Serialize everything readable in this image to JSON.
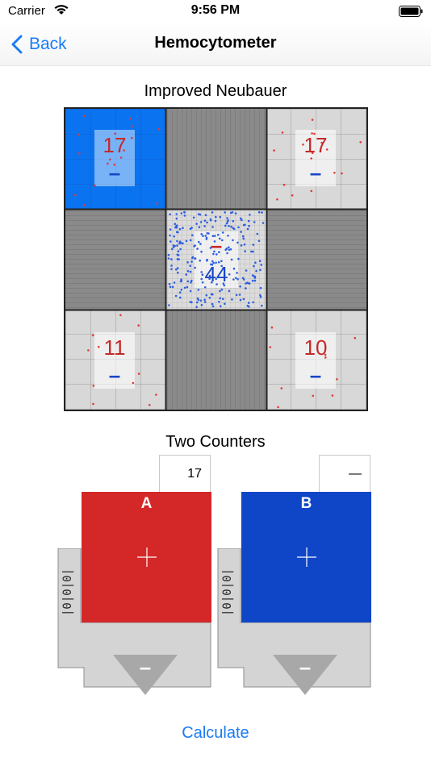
{
  "status_bar": {
    "carrier": "Carrier",
    "time": "9:56 PM"
  },
  "nav": {
    "back_label": "Back",
    "title": "Hemocytometer"
  },
  "grid": {
    "title": "Improved Neubauer",
    "squares": {
      "top_left": {
        "count": "17",
        "minus": "–",
        "selected": true
      },
      "top_right": {
        "count": "17",
        "minus": "–",
        "selected": false
      },
      "center": {
        "count": "44",
        "minus": "–"
      },
      "bottom_left": {
        "count": "11",
        "minus": "–",
        "selected": false
      },
      "bottom_right": {
        "count": "10",
        "minus": "–",
        "selected": false
      }
    }
  },
  "counters": {
    "title": "Two Counters",
    "a": {
      "label": "A",
      "value": "17",
      "color": "#d42727"
    },
    "b": {
      "label": "B",
      "value": "—",
      "color": "#0f46c8"
    },
    "tally_text": "|0|0|0|",
    "minus": "–"
  },
  "colors": {
    "accent": "#1a7cf5",
    "selected_square": "#0a73f0",
    "count_red": "#c62828",
    "count_blue": "#1846c9",
    "counter_body": "#d4d4d4"
  },
  "calculate_label": "Calculate"
}
